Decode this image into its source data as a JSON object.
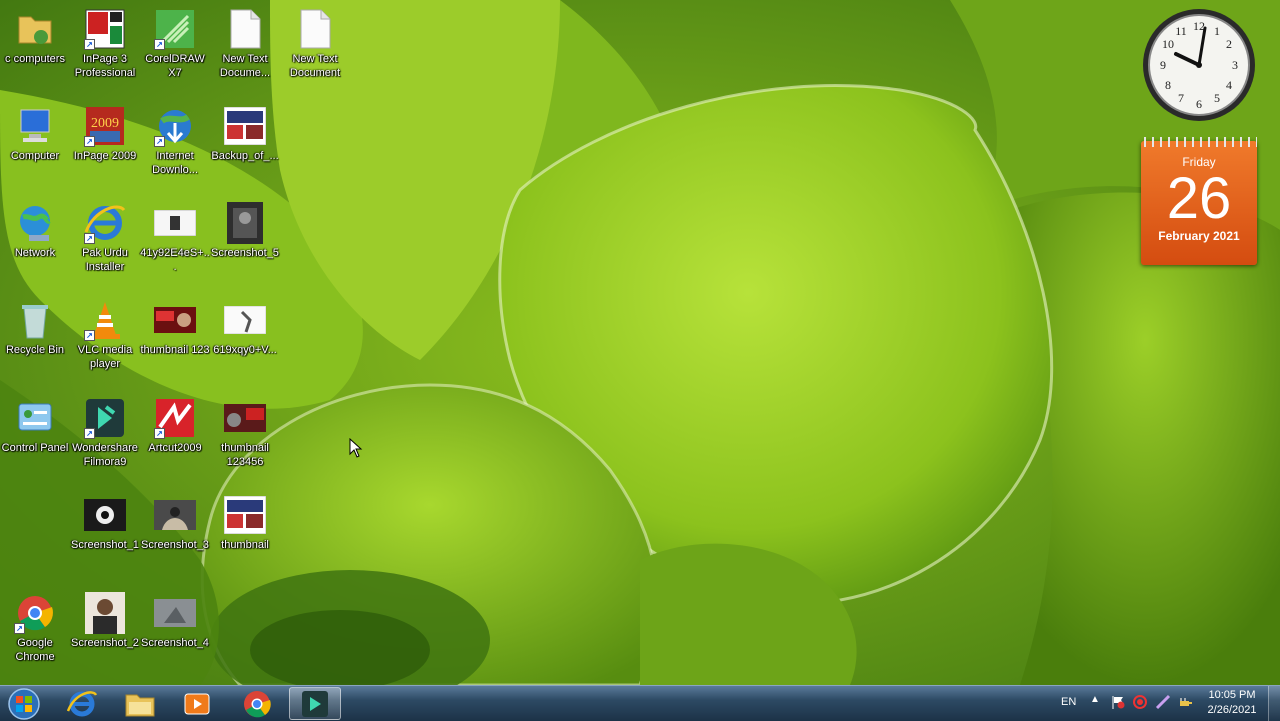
{
  "desktop": {
    "icons": [
      {
        "id": "computers-folder",
        "label": "c computers"
      },
      {
        "id": "inpage3",
        "label": "InPage 3 Professional"
      },
      {
        "id": "coreldraw",
        "label": "CorelDRAW X7"
      },
      {
        "id": "new-text-1",
        "label": "New Text Docume..."
      },
      {
        "id": "new-text-2",
        "label": "New Text Document"
      },
      {
        "id": "computer",
        "label": "Computer"
      },
      {
        "id": "inpage2009",
        "label": "InPage 2009"
      },
      {
        "id": "idm",
        "label": "Internet Downlo..."
      },
      {
        "id": "backup",
        "label": "Backup_of_..."
      },
      {
        "id": "network",
        "label": "Network"
      },
      {
        "id": "pak-urdu",
        "label": "Pak Urdu Installer"
      },
      {
        "id": "file-41y",
        "label": "41y92E4eS+..."
      },
      {
        "id": "screenshot5",
        "label": "Screenshot_5"
      },
      {
        "id": "recycle",
        "label": "Recycle Bin"
      },
      {
        "id": "vlc",
        "label": "VLC media player"
      },
      {
        "id": "thumb123",
        "label": "thumbnail 123"
      },
      {
        "id": "file-619",
        "label": "619xqy0+V..."
      },
      {
        "id": "control-panel",
        "label": "Control Panel"
      },
      {
        "id": "filmora",
        "label": "Wondershare Filmora9"
      },
      {
        "id": "artcut",
        "label": "Artcut2009"
      },
      {
        "id": "thumb123456",
        "label": "thumbnail 123456"
      },
      {
        "id": "screenshot1",
        "label": "Screenshot_1"
      },
      {
        "id": "screenshot3",
        "label": "Screenshot_3"
      },
      {
        "id": "thumbnail",
        "label": "thumbnail"
      },
      {
        "id": "chrome",
        "label": "Google Chrome"
      },
      {
        "id": "screenshot2",
        "label": "Screenshot_2"
      },
      {
        "id": "screenshot4",
        "label": "Screenshot_4"
      }
    ]
  },
  "gadgets": {
    "clock": {
      "time": "10:05"
    },
    "calendar": {
      "day": "Friday",
      "date": "26",
      "month_year": "February 2021"
    }
  },
  "taskbar": {
    "pinned": [
      {
        "name": "Internet Explorer",
        "icon": "ie-icon"
      },
      {
        "name": "Windows Explorer",
        "icon": "folder-icon"
      },
      {
        "name": "Windows Media Player",
        "icon": "media-player-icon"
      },
      {
        "name": "Google Chrome",
        "icon": "chrome-icon"
      },
      {
        "name": "Wondershare Filmora9",
        "icon": "filmora-icon",
        "active": true
      }
    ],
    "tray": {
      "language": "EN",
      "time": "10:05 PM",
      "date": "2/26/2021"
    }
  }
}
